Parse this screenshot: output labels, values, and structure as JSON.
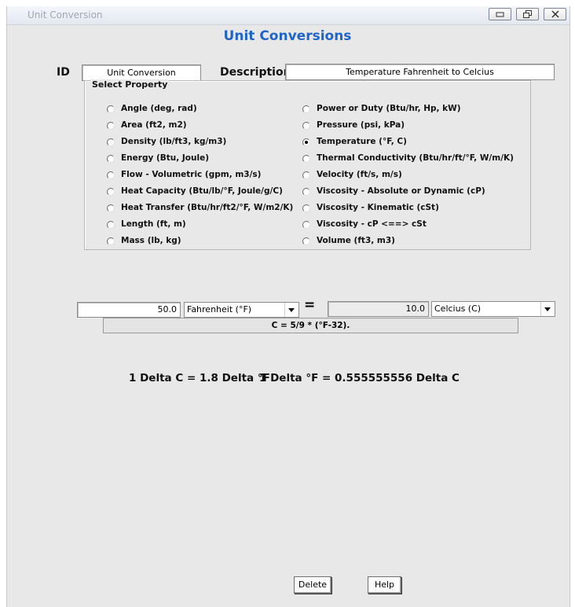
{
  "window": {
    "title": "Unit Conversion"
  },
  "heading": "Unit Conversions",
  "id_label": "ID",
  "id_value": "Unit Conversion",
  "description_label": "Description",
  "description_value": "Temperature Fahrenheit to Celcius",
  "group_label": "Select Property",
  "properties_left": [
    "Angle (deg, rad)",
    "Area (ft2, m2)",
    "Density (lb/ft3, kg/m3)",
    "Energy (Btu, Joule)",
    "Flow - Volumetric (gpm, m3/s)",
    "Heat Capacity (Btu/lb/°F, Joule/g/C)",
    "Heat Transfer (Btu/hr/ft2/°F, W/m2/K)",
    "Length (ft, m)",
    "Mass (lb, kg)"
  ],
  "properties_right": [
    "Power or Duty (Btu/hr, Hp, kW)",
    "Pressure (psi, kPa)",
    "Temperature (°F, C)",
    "Thermal Conductivity (Btu/hr/ft/°F, W/m/K)",
    "Velocity (ft/s, m/s)",
    "Viscosity - Absolute or Dynamic (cP)",
    "Viscosity - Kinematic (cSt)",
    "Viscosity - cP <==> cSt",
    "Volume (ft3, m3)"
  ],
  "selected_property": "Temperature (°F, C)",
  "conversion": {
    "input_value": "50.0",
    "from_unit": "Fahrenheit (°F)",
    "equals": "=",
    "output_value": "10.0",
    "to_unit": "Celcius (C)",
    "formula": "C = 5/9 * (°F-32)."
  },
  "delta_1": "1 Delta C = 1.8 Delta °F",
  "delta_2": "1 Delta °F = 0.555555556 Delta C",
  "buttons": {
    "delete": "Delete",
    "help": "Help"
  }
}
